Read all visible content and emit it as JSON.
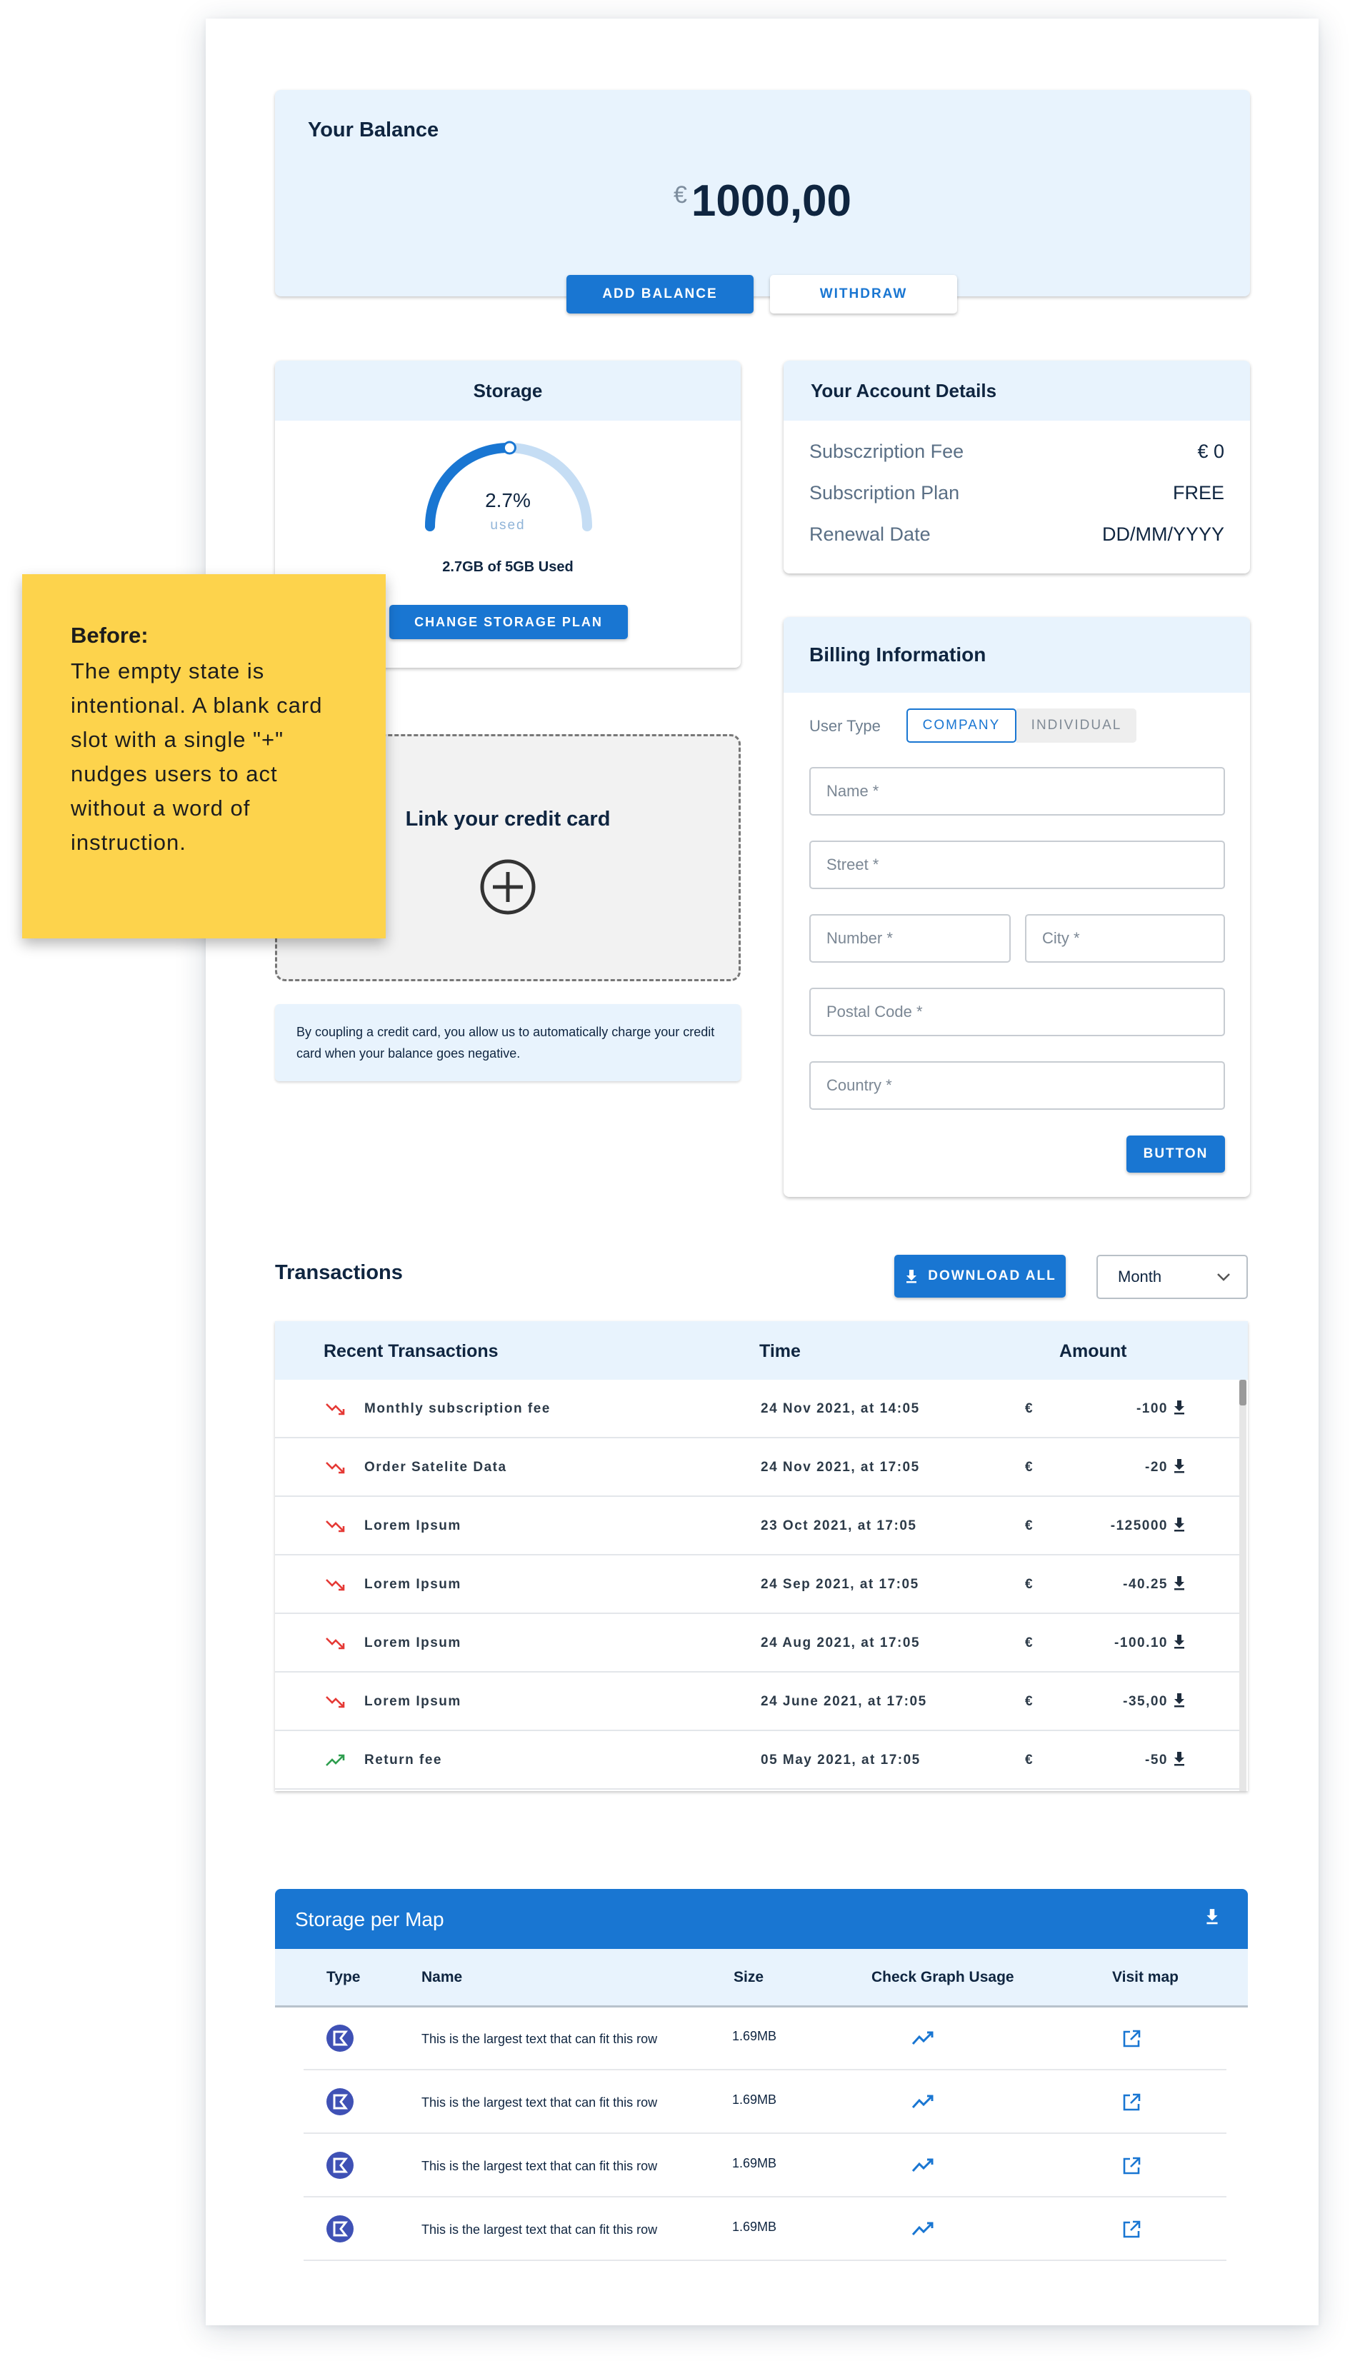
{
  "balance": {
    "title": "Your Balance",
    "currency": "€",
    "amount": "1000,00",
    "add_label": "ADD BALANCE",
    "withdraw_label": "WITHDRAW"
  },
  "storage": {
    "title": "Storage",
    "percent": "2.7%",
    "percent_value": 2.7,
    "used_word": "used",
    "used_text": "2.7GB of 5GB Used",
    "change_label": "CHANGE STORAGE PLAN"
  },
  "account": {
    "title": "Your Account Details",
    "rows": [
      {
        "label": "Subsczription Fee",
        "value": "€ 0"
      },
      {
        "label": "Subscription Plan",
        "value": "FREE"
      },
      {
        "label": "Renewal Date",
        "value": "DD/MM/YYYY"
      }
    ]
  },
  "note": {
    "title": "Before:",
    "body": "The empty state is intentional. A blank card slot with a single \"+\" nudges users to act without a word of instruction."
  },
  "credit_card": {
    "title": "Link your credit card",
    "info": "By coupling a credit card, you allow us to automatically charge your credit card when your balance goes negative."
  },
  "billing": {
    "title": "Billing Information",
    "user_type_label": "User Type",
    "company_label": "COMPANY",
    "individual_label": "INDIVIDUAL",
    "placeholders": {
      "name": "Name *",
      "street": "Street *",
      "number": "Number *",
      "city": "City *",
      "postal": "Postal Code *",
      "country": "Country *"
    },
    "button_label": "BUTTON"
  },
  "transactions": {
    "title": "Transactions",
    "download_label": "DOWNLOAD ALL",
    "period": "Month",
    "columns": {
      "recent": "Recent Transactions",
      "time": "Time",
      "amount": "Amount"
    },
    "rows": [
      {
        "name": "Monthly subscription fee",
        "time": "24 Nov 2021, at 14:05",
        "currency": "€",
        "amount": "-100",
        "trend": "down"
      },
      {
        "name": "Order Satelite Data",
        "time": "24 Nov 2021, at 17:05",
        "currency": "€",
        "amount": "-20",
        "trend": "down"
      },
      {
        "name": "Lorem Ipsum",
        "time": "23 Oct 2021, at 17:05",
        "currency": "€",
        "amount": "-125000",
        "trend": "down"
      },
      {
        "name": "Lorem Ipsum",
        "time": "24 Sep 2021, at 17:05",
        "currency": "€",
        "amount": "-40.25",
        "trend": "down"
      },
      {
        "name": "Lorem Ipsum",
        "time": "24 Aug 2021, at 17:05",
        "currency": "€",
        "amount": "-100.10",
        "trend": "down"
      },
      {
        "name": "Lorem Ipsum",
        "time": "24 June 2021, at 17:05",
        "currency": "€",
        "amount": "-35,00",
        "trend": "down"
      },
      {
        "name": "Return fee",
        "time": "05 May 2021, at 17:05",
        "currency": "€",
        "amount": "-50",
        "trend": "up"
      }
    ]
  },
  "storage_map": {
    "title": "Storage per Map",
    "columns": {
      "type": "Type",
      "name": "Name",
      "size": "Size",
      "graph": "Check Graph Usage",
      "visit": "Visit map"
    },
    "rows": [
      {
        "name": "This is the largest text that can fit this row",
        "size": "1.69MB"
      },
      {
        "name": "This is the largest text that can fit this row",
        "size": "1.69MB"
      },
      {
        "name": "This is the largest text that can fit this row",
        "size": "1.69MB"
      },
      {
        "name": "This is the largest text that can fit this row",
        "size": "1.69MB"
      }
    ]
  },
  "colors": {
    "primary": "#1976d2",
    "light_blue": "#e8f3fd",
    "note_yellow": "#fdd34c",
    "negative": "#e53935",
    "positive": "#2e9e4f",
    "map_icon": "#3f51b5"
  }
}
